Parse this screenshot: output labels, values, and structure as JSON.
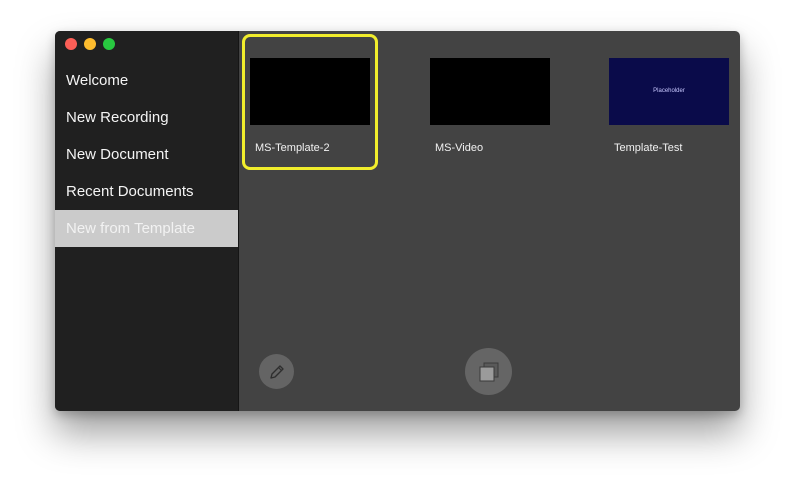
{
  "sidebar": {
    "items": [
      {
        "label": "Welcome"
      },
      {
        "label": "New Recording"
      },
      {
        "label": "New Document"
      },
      {
        "label": "Recent Documents"
      },
      {
        "label": "New from Template",
        "selected": true
      }
    ]
  },
  "templates": [
    {
      "name": "MS-Template-2",
      "selected": true,
      "thumbnail_text": ""
    },
    {
      "name": "MS-Video",
      "selected": false,
      "thumbnail_text": ""
    },
    {
      "name": "Template-Test",
      "selected": false,
      "thumbnail_text": "Placeholder"
    }
  ],
  "toolbar": {
    "edit_icon": "pencil-icon",
    "duplicate_icon": "duplicate-icon"
  },
  "colors": {
    "selection_outline": "#f1ed2c",
    "sidebar_bg": "#202020",
    "content_bg": "#434343",
    "sidebar_selected_bg": "#cbcbcb"
  }
}
